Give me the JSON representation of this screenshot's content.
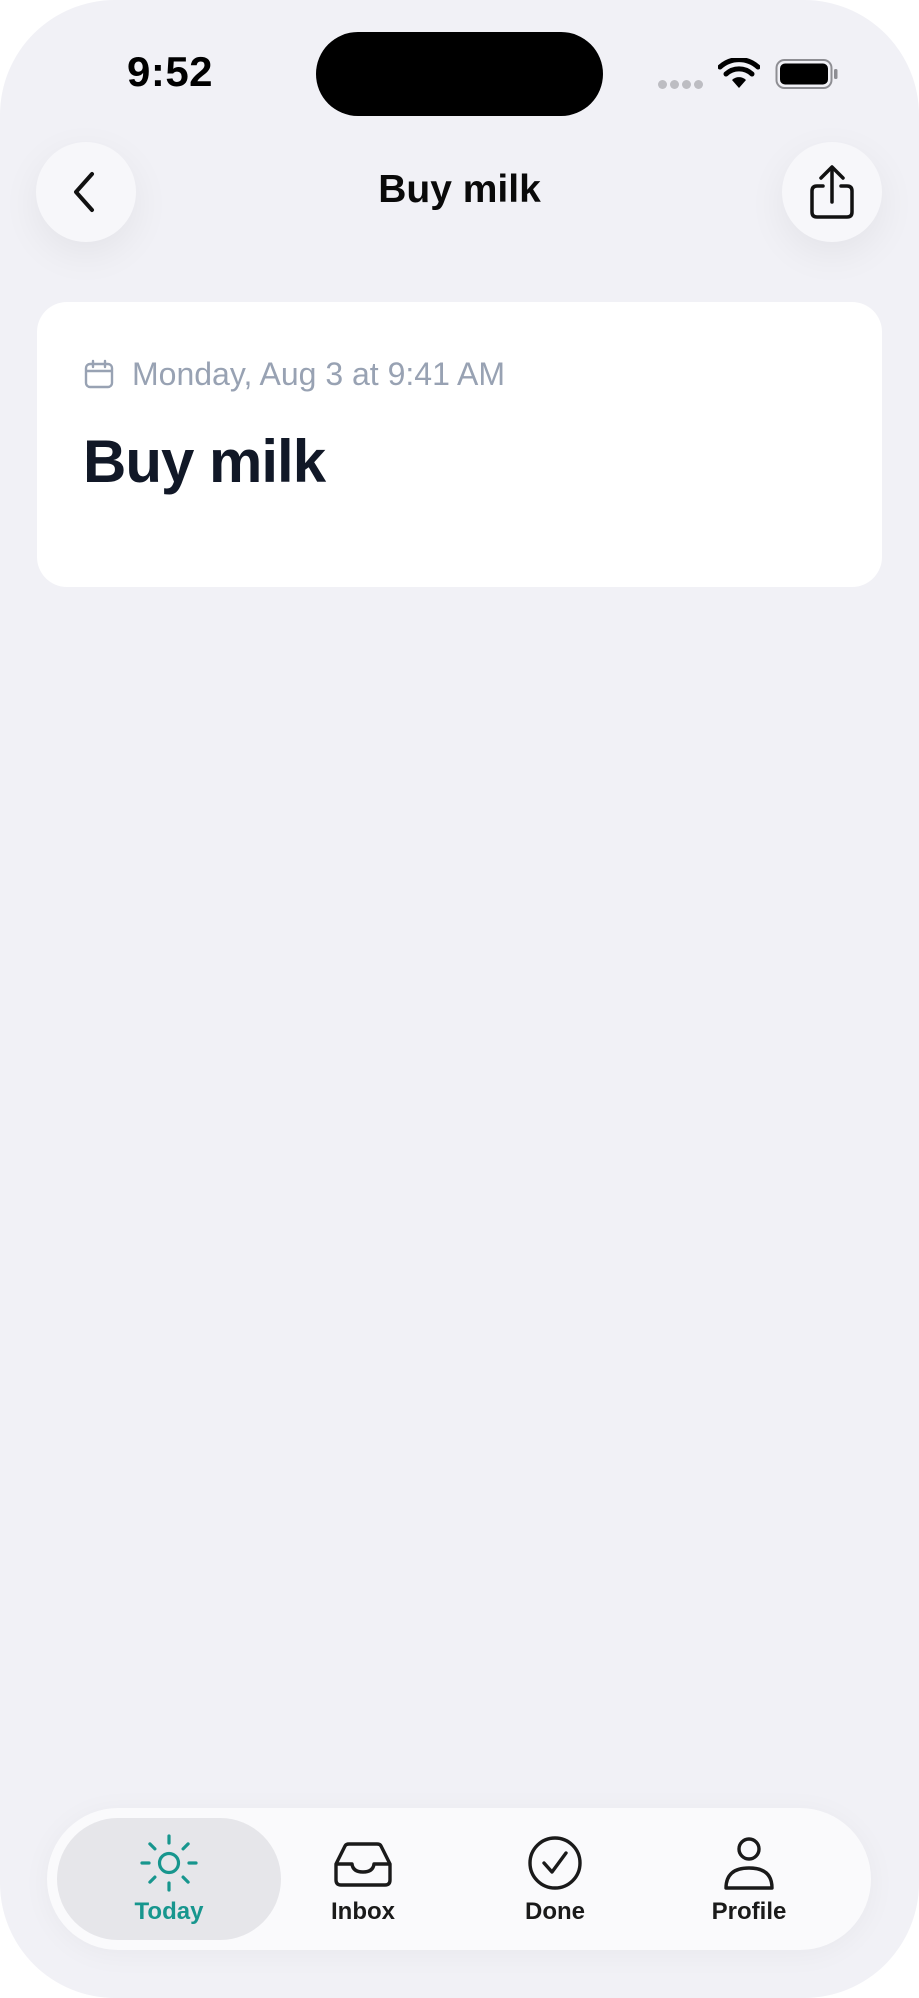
{
  "status_bar": {
    "time": "9:52"
  },
  "header": {
    "title": "Buy milk",
    "back_icon": "chevron-left-icon",
    "share_icon": "share-icon"
  },
  "task": {
    "date_icon": "calendar-icon",
    "date": "Monday, Aug 3 at 9:41 AM",
    "title": "Buy milk"
  },
  "tab_bar": {
    "active": "Today",
    "tabs": [
      {
        "label": "Today",
        "icon": "sun-icon"
      },
      {
        "label": "Inbox",
        "icon": "inbox-tray-icon"
      },
      {
        "label": "Done",
        "icon": "check-circle-icon"
      },
      {
        "label": "Profile",
        "icon": "person-icon"
      }
    ]
  },
  "colors": {
    "background": "#f1f1f6",
    "card": "#ffffff",
    "accent": "#17968e",
    "muted_text": "#98a2b3",
    "title_text": "#111827"
  }
}
